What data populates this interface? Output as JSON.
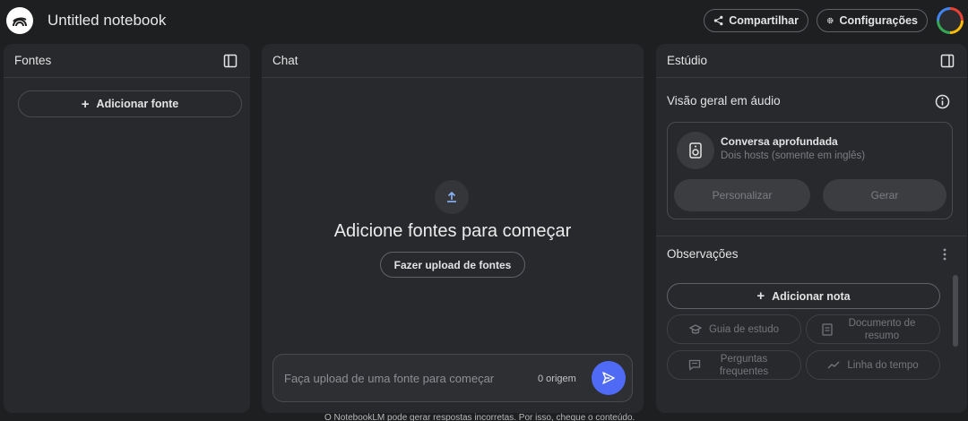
{
  "app": {
    "title": "Untitled notebook",
    "share_label": "Compartilhar",
    "settings_label": "Configurações"
  },
  "sources": {
    "title": "Fontes",
    "add_label": "Adicionar fonte"
  },
  "chat": {
    "title": "Chat",
    "empty_title": "Adicione fontes para começar",
    "upload_label": "Fazer upload de fontes",
    "input_placeholder": "Faça upload de uma fonte para começar",
    "source_count": "0 origem"
  },
  "studio": {
    "title": "Estúdio",
    "audio_section_title": "Visão geral em áudio",
    "audio_card": {
      "title": "Conversa aprofundada",
      "subtitle": "Dois hosts (somente em inglês)",
      "customize_label": "Personalizar",
      "generate_label": "Gerar"
    },
    "notes_title": "Observações",
    "add_note_label": "Adicionar nota",
    "note_chips": [
      {
        "label": "Guia de estudo",
        "icon": "graduation-cap-icon"
      },
      {
        "label": "Documento de resumo",
        "icon": "document-icon"
      },
      {
        "label": "Perguntas frequentes",
        "icon": "chat-icon"
      },
      {
        "label": "Linha do tempo",
        "icon": "timeline-icon"
      }
    ]
  },
  "footer": {
    "text": "O NotebookLM pode gerar respostas incorretas. Por isso, cheque o conteúdo."
  },
  "colors": {
    "background": "#1e1f21",
    "panel": "#28292d",
    "accent": "#4f6bf5"
  }
}
